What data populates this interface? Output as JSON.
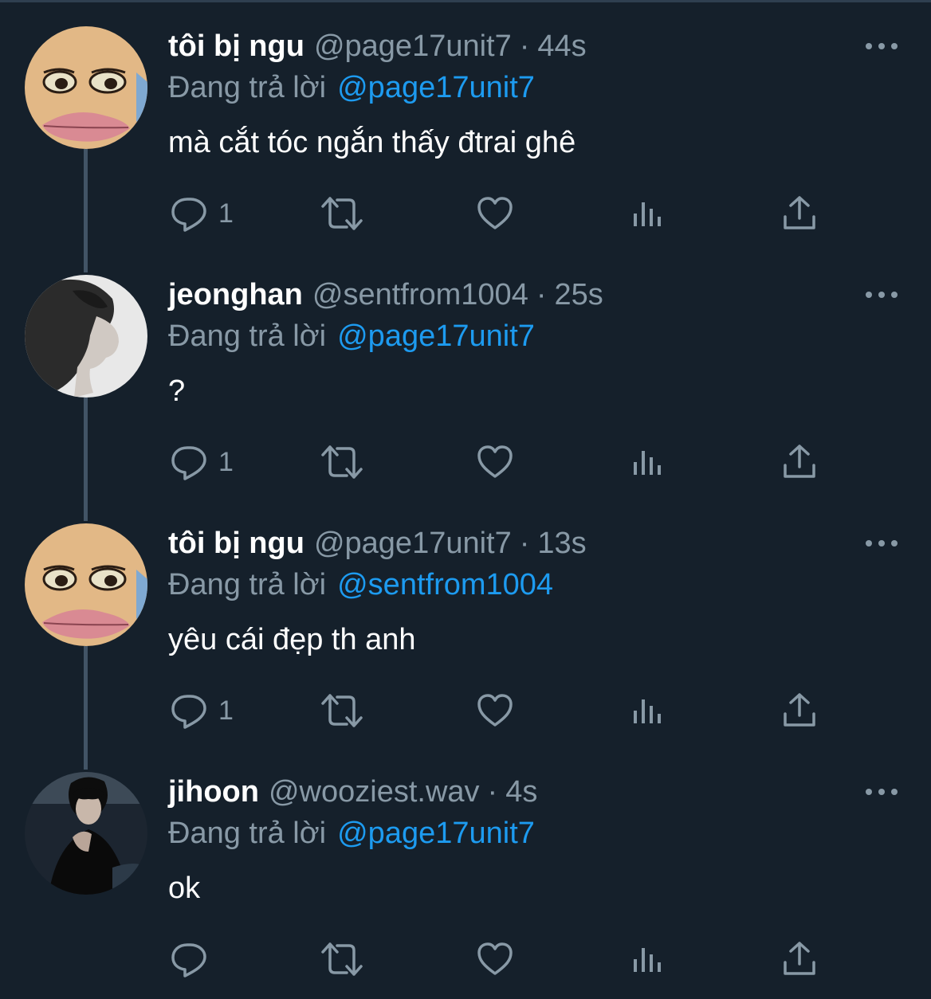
{
  "reply_prefix": "Đang trả lời",
  "colors": {
    "background": "#15202b",
    "secondary_text": "#8899a6",
    "mention": "#1d9bf0",
    "thread_line": "#425466"
  },
  "tweets": [
    {
      "name": "tôi bị ngu",
      "handle": "@page17unit7",
      "separator": "·",
      "time": "44s",
      "reply_to": "@page17unit7",
      "text": "mà cắt tóc ngắn thấy đtrai ghê",
      "reply_count": "1",
      "avatar": "meme-face-avatar"
    },
    {
      "name": "jeonghan",
      "handle": "@sentfrom1004",
      "separator": "·",
      "time": "25s",
      "reply_to": "@page17unit7",
      "text": "?",
      "reply_count": "1",
      "avatar": "grayscale-profile-avatar"
    },
    {
      "name": "tôi bị ngu",
      "handle": "@page17unit7",
      "separator": "·",
      "time": "13s",
      "reply_to": "@sentfrom1004",
      "text": "yêu cái đẹp th anh",
      "reply_count": "1",
      "avatar": "meme-face-avatar"
    },
    {
      "name": "jihoon",
      "handle": "@wooziest.wav",
      "separator": "·",
      "time": "4s",
      "reply_to": "@page17unit7",
      "text": "ok",
      "reply_count": "",
      "avatar": "dark-photo-avatar"
    }
  ],
  "icons": {
    "reply": "reply-icon",
    "retweet": "retweet-icon",
    "like": "like-icon",
    "views": "views-icon",
    "share": "share-icon",
    "more": "more-icon"
  }
}
